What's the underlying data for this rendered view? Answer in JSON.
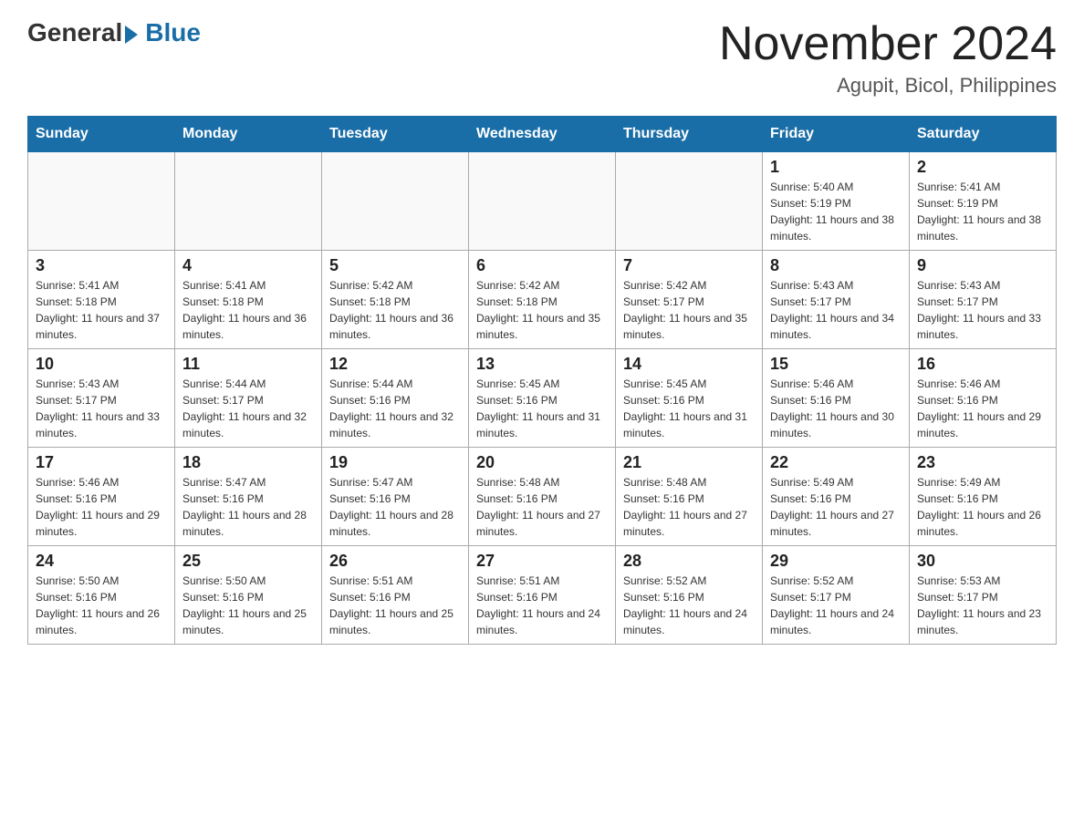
{
  "logo": {
    "general": "General",
    "blue": "Blue",
    "subtitle": ""
  },
  "header": {
    "month_year": "November 2024",
    "location": "Agupit, Bicol, Philippines"
  },
  "weekdays": [
    "Sunday",
    "Monday",
    "Tuesday",
    "Wednesday",
    "Thursday",
    "Friday",
    "Saturday"
  ],
  "weeks": [
    [
      {
        "day": "",
        "info": ""
      },
      {
        "day": "",
        "info": ""
      },
      {
        "day": "",
        "info": ""
      },
      {
        "day": "",
        "info": ""
      },
      {
        "day": "",
        "info": ""
      },
      {
        "day": "1",
        "info": "Sunrise: 5:40 AM\nSunset: 5:19 PM\nDaylight: 11 hours and 38 minutes."
      },
      {
        "day": "2",
        "info": "Sunrise: 5:41 AM\nSunset: 5:19 PM\nDaylight: 11 hours and 38 minutes."
      }
    ],
    [
      {
        "day": "3",
        "info": "Sunrise: 5:41 AM\nSunset: 5:18 PM\nDaylight: 11 hours and 37 minutes."
      },
      {
        "day": "4",
        "info": "Sunrise: 5:41 AM\nSunset: 5:18 PM\nDaylight: 11 hours and 36 minutes."
      },
      {
        "day": "5",
        "info": "Sunrise: 5:42 AM\nSunset: 5:18 PM\nDaylight: 11 hours and 36 minutes."
      },
      {
        "day": "6",
        "info": "Sunrise: 5:42 AM\nSunset: 5:18 PM\nDaylight: 11 hours and 35 minutes."
      },
      {
        "day": "7",
        "info": "Sunrise: 5:42 AM\nSunset: 5:17 PM\nDaylight: 11 hours and 35 minutes."
      },
      {
        "day": "8",
        "info": "Sunrise: 5:43 AM\nSunset: 5:17 PM\nDaylight: 11 hours and 34 minutes."
      },
      {
        "day": "9",
        "info": "Sunrise: 5:43 AM\nSunset: 5:17 PM\nDaylight: 11 hours and 33 minutes."
      }
    ],
    [
      {
        "day": "10",
        "info": "Sunrise: 5:43 AM\nSunset: 5:17 PM\nDaylight: 11 hours and 33 minutes."
      },
      {
        "day": "11",
        "info": "Sunrise: 5:44 AM\nSunset: 5:17 PM\nDaylight: 11 hours and 32 minutes."
      },
      {
        "day": "12",
        "info": "Sunrise: 5:44 AM\nSunset: 5:16 PM\nDaylight: 11 hours and 32 minutes."
      },
      {
        "day": "13",
        "info": "Sunrise: 5:45 AM\nSunset: 5:16 PM\nDaylight: 11 hours and 31 minutes."
      },
      {
        "day": "14",
        "info": "Sunrise: 5:45 AM\nSunset: 5:16 PM\nDaylight: 11 hours and 31 minutes."
      },
      {
        "day": "15",
        "info": "Sunrise: 5:46 AM\nSunset: 5:16 PM\nDaylight: 11 hours and 30 minutes."
      },
      {
        "day": "16",
        "info": "Sunrise: 5:46 AM\nSunset: 5:16 PM\nDaylight: 11 hours and 29 minutes."
      }
    ],
    [
      {
        "day": "17",
        "info": "Sunrise: 5:46 AM\nSunset: 5:16 PM\nDaylight: 11 hours and 29 minutes."
      },
      {
        "day": "18",
        "info": "Sunrise: 5:47 AM\nSunset: 5:16 PM\nDaylight: 11 hours and 28 minutes."
      },
      {
        "day": "19",
        "info": "Sunrise: 5:47 AM\nSunset: 5:16 PM\nDaylight: 11 hours and 28 minutes."
      },
      {
        "day": "20",
        "info": "Sunrise: 5:48 AM\nSunset: 5:16 PM\nDaylight: 11 hours and 27 minutes."
      },
      {
        "day": "21",
        "info": "Sunrise: 5:48 AM\nSunset: 5:16 PM\nDaylight: 11 hours and 27 minutes."
      },
      {
        "day": "22",
        "info": "Sunrise: 5:49 AM\nSunset: 5:16 PM\nDaylight: 11 hours and 27 minutes."
      },
      {
        "day": "23",
        "info": "Sunrise: 5:49 AM\nSunset: 5:16 PM\nDaylight: 11 hours and 26 minutes."
      }
    ],
    [
      {
        "day": "24",
        "info": "Sunrise: 5:50 AM\nSunset: 5:16 PM\nDaylight: 11 hours and 26 minutes."
      },
      {
        "day": "25",
        "info": "Sunrise: 5:50 AM\nSunset: 5:16 PM\nDaylight: 11 hours and 25 minutes."
      },
      {
        "day": "26",
        "info": "Sunrise: 5:51 AM\nSunset: 5:16 PM\nDaylight: 11 hours and 25 minutes."
      },
      {
        "day": "27",
        "info": "Sunrise: 5:51 AM\nSunset: 5:16 PM\nDaylight: 11 hours and 24 minutes."
      },
      {
        "day": "28",
        "info": "Sunrise: 5:52 AM\nSunset: 5:16 PM\nDaylight: 11 hours and 24 minutes."
      },
      {
        "day": "29",
        "info": "Sunrise: 5:52 AM\nSunset: 5:17 PM\nDaylight: 11 hours and 24 minutes."
      },
      {
        "day": "30",
        "info": "Sunrise: 5:53 AM\nSunset: 5:17 PM\nDaylight: 11 hours and 23 minutes."
      }
    ]
  ]
}
